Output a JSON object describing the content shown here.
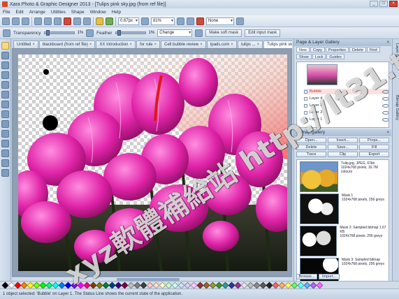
{
  "window": {
    "title": "Xara Photo & Graphic Designer 2013 - [Tulips pink sky.jpg (from ref file)]",
    "controls": [
      "_",
      "□",
      "×"
    ]
  },
  "menu": [
    "File",
    "Edit",
    "Arrange",
    "Utilities",
    "Shape",
    "Window",
    "Help"
  ],
  "toolbar": {
    "zoom_value": "0.67px",
    "zoom_percent": "81%",
    "name_field": "None"
  },
  "infobar": {
    "transparency_label": "Transparency",
    "transparency_value": "1%",
    "feather_label": "Feather",
    "feather_value": "1%",
    "mode_select": "Change",
    "make_mask_button": "Make soft mask",
    "edit_mask_button": "Edit input mask"
  },
  "doc_tabs": [
    "Untitled",
    "blackboard (from ref file)",
    "XX Introduction",
    "for rule",
    "Cell bubble review",
    "Ipads.com",
    "tulips ...",
    "Tulips pink sky.jpg"
  ],
  "layers_panel": {
    "title": "Page & Layer Gallery",
    "tabs": [
      "New",
      "Copy",
      "Properties",
      "Delete",
      "Find",
      "Show",
      "Lock",
      "Guides"
    ],
    "layers": [
      "Bubble",
      "Layer 4",
      "Layer 3",
      "Layer 2",
      "Layer 1"
    ],
    "selected_layer": "Bubble"
  },
  "bitmap_panel": {
    "title": "Bitmap gallery",
    "buttons": [
      "Open...",
      "Insert...",
      "Props...",
      "Delete",
      "Save...",
      "Fill",
      "Trace",
      "Clip",
      "Export"
    ],
    "items": [
      {
        "name": "Tulip.jpg, JPEG, 67kb",
        "detail": "1024x768 pixels, 16.7M colours"
      },
      {
        "name": "Mask 1",
        "detail": "1024x768 pixels, 256 greys"
      },
      {
        "name": "Mask 2: Sampled bitmap 1.67 KB",
        "detail": "1024x768 pixels, 256 greys"
      },
      {
        "name": "Mask 3: Sampled bitmap",
        "detail": "1024x768 pixels, 256 greys"
      }
    ],
    "footer_buttons": [
      "Browse...",
      "Import..."
    ]
  },
  "side_tabs": [
    "Layer Gallery",
    "Bitmap Gallery"
  ],
  "palette": [
    "#000000",
    "#ffffff",
    "#ff0000",
    "#ff8000",
    "#ffff00",
    "#80ff00",
    "#00ff00",
    "#00ff80",
    "#00ffff",
    "#0080ff",
    "#0000ff",
    "#8000ff",
    "#ff00ff",
    "#ff0080",
    "#804000",
    "#808000",
    "#008040",
    "#004080",
    "#400080",
    "#800040",
    "#c0c0c0",
    "#808080",
    "#404040",
    "#ffcccc",
    "#ffe5cc",
    "#ffffcc",
    "#ccffcc",
    "#ccffff",
    "#cce5ff",
    "#e5ccff",
    "#ffccff",
    "#993333",
    "#996633",
    "#999933",
    "#339933",
    "#339999",
    "#333399",
    "#993399",
    "#e8e8e8",
    "#bfbfbf",
    "#8c8c8c",
    "#595959",
    "#262626",
    "#ff6666",
    "#ffb366",
    "#ffff66",
    "#66ff66",
    "#66ffff",
    "#66b3ff",
    "#b366ff",
    "#ff66ff"
  ],
  "status": "1 object selected: 'Bubble' on Layer 1. The Status Line shows the current state of the application."
}
